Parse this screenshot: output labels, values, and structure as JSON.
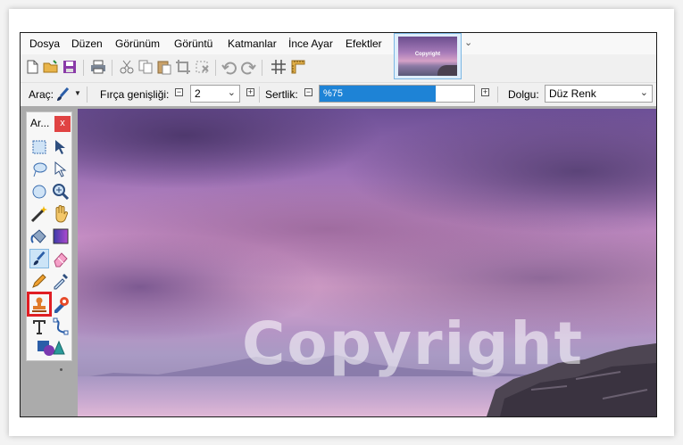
{
  "menu": {
    "items": [
      "Dosya",
      "Düzen",
      "Görünüm",
      "Görüntü",
      "Katmanlar",
      "İnce Ayar",
      "Efektler"
    ]
  },
  "image_tab": {
    "watermark": "Copyright"
  },
  "toolbar2": {
    "tool_label": "Araç:",
    "brush_width_label": "Fırça genişliği:",
    "brush_width_value": "2",
    "hardness_label": "Sertlik:",
    "hardness_value": "%75",
    "hardness_fraction": 0.75,
    "fill_label": "Dolgu:",
    "fill_value": "Düz Renk"
  },
  "tools_panel": {
    "title": "Ar...",
    "close": "x"
  },
  "canvas": {
    "watermark": "Copyright"
  },
  "colors": {
    "accent": "#1e83d6",
    "highlight": "#e01e24",
    "close": "#e04343"
  }
}
